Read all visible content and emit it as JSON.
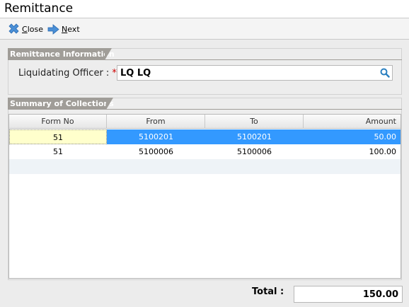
{
  "window": {
    "title": "Remittance"
  },
  "toolbar": {
    "close_label_underlined": "C",
    "close_label_rest": "lose",
    "next_label_underlined": "N",
    "next_label_rest": "ext"
  },
  "remittance_info": {
    "header": "Remittance Information",
    "liquidating_officer_label": "Liquidating Officer :",
    "required_marker": "*",
    "liquidating_officer_value": "LQ LQ"
  },
  "collections": {
    "header": "Summary of Collections",
    "columns": [
      "Form No",
      "From",
      "To",
      "Amount"
    ],
    "rows": [
      {
        "form_no": "51",
        "from": "5100201",
        "to": "5100201",
        "amount": "50.00"
      },
      {
        "form_no": "51",
        "from": "5100006",
        "to": "5100006",
        "amount": "100.00"
      }
    ]
  },
  "footer": {
    "total_label": "Total :",
    "total_value": "150.00"
  },
  "colors": {
    "section_tab": "#a09d98",
    "selected_row": "#3399ff",
    "selected_cell": "#ffffcc"
  }
}
